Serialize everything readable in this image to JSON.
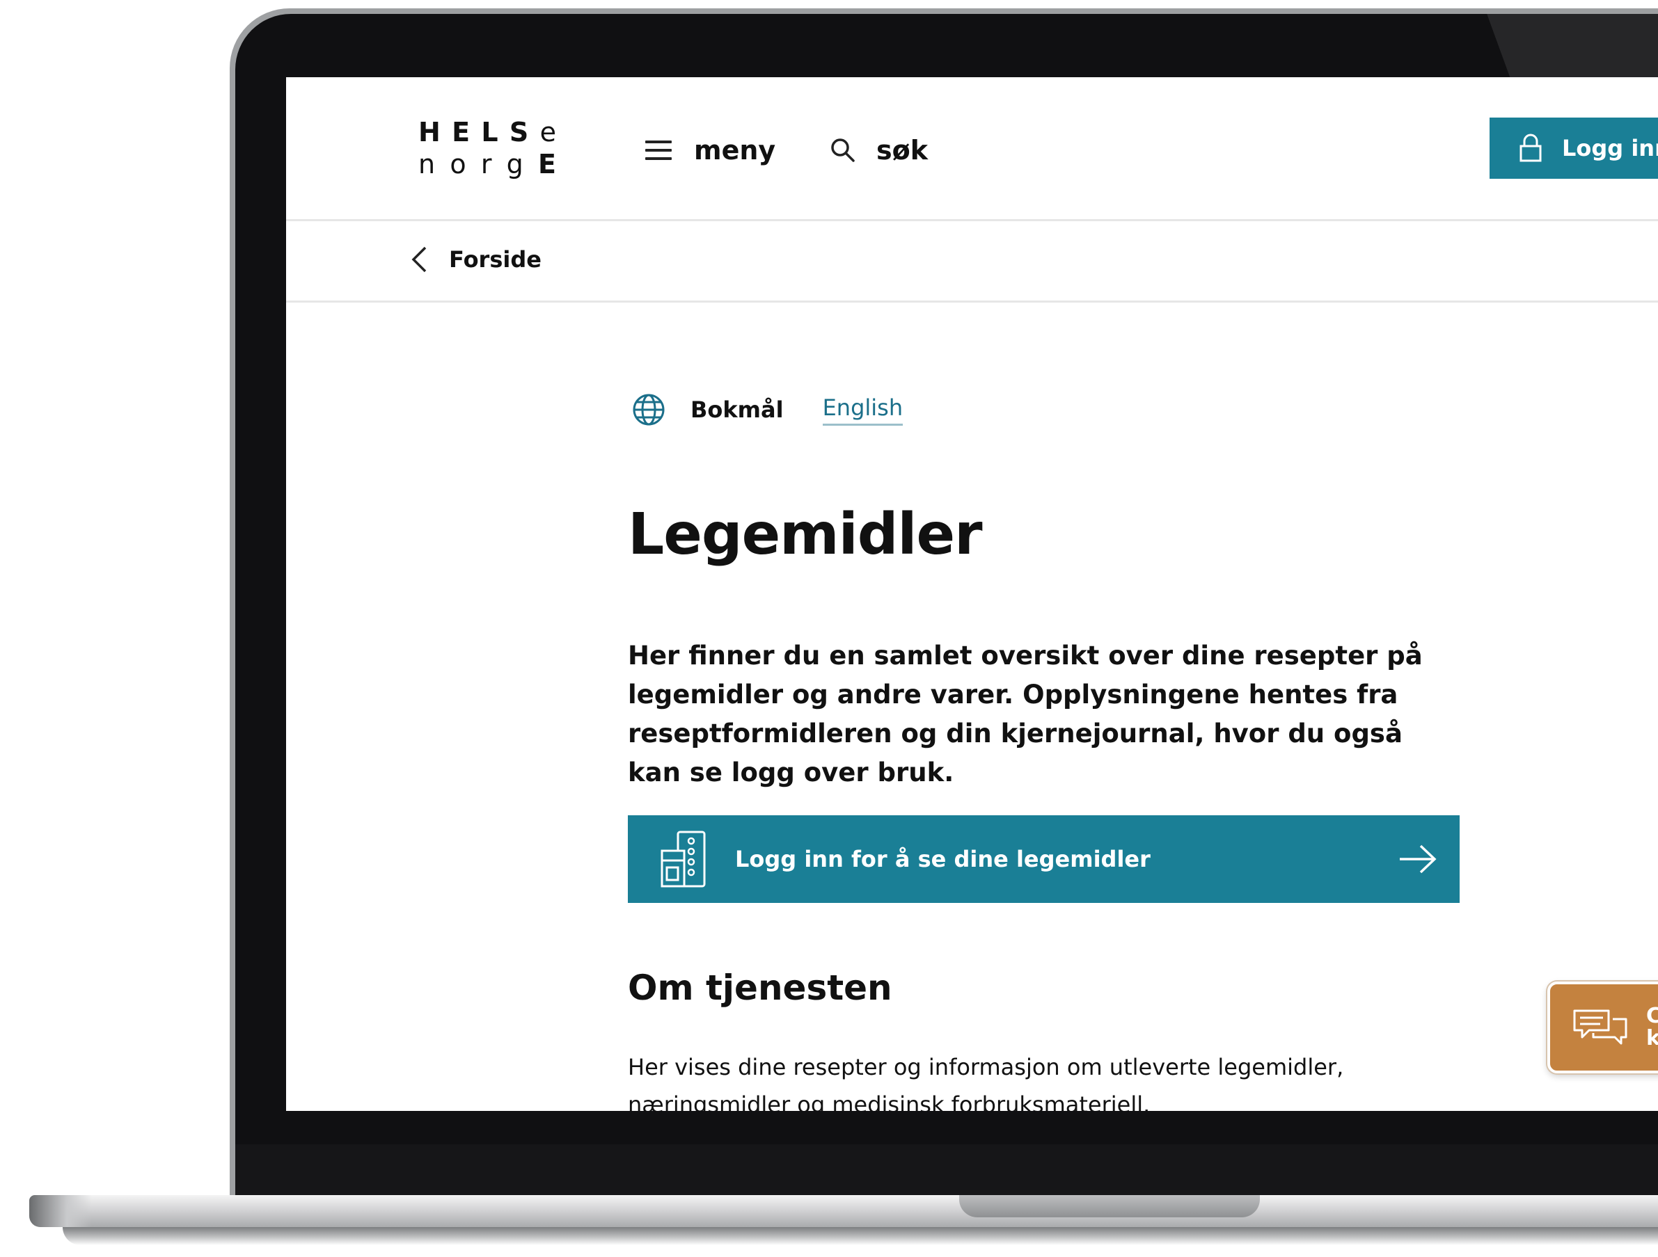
{
  "header": {
    "logo": {
      "line1": [
        "H",
        "E",
        "L",
        "S",
        "e"
      ],
      "line2": [
        "n",
        "o",
        "r",
        "g",
        "E"
      ]
    },
    "menu_label": "meny",
    "search_label": "søk",
    "login_label": "Logg inn"
  },
  "breadcrumb": {
    "label": "Forside"
  },
  "language": {
    "current": "Bokmål",
    "alternative": "English"
  },
  "main": {
    "title": "Legemidler",
    "lead": "Her finner du en samlet oversikt over dine resepter på legemidler og andre varer. Opplysningene hentes fra reseptformidleren og din kjernejournal, hvor du også kan se logg over bruk.",
    "cta_label": "Logg inn for å se dine legemidler",
    "section_title": "Om tjenesten",
    "section_text": "Her vises dine resepter og informasjon om utleverte legemidler, næringsmidler og medisinsk forbruksmateriell."
  },
  "chat": {
    "line1": "C",
    "line2": "k"
  },
  "colors": {
    "brand": "#1a7f96",
    "link": "#1b6f8a",
    "chat": "#c4823f"
  },
  "icons": [
    "hamburger-icon",
    "search-icon",
    "lock-icon",
    "chevron-left-icon",
    "globe-icon",
    "medicine-icon",
    "arrow-right-icon",
    "chat-bubbles-icon"
  ]
}
